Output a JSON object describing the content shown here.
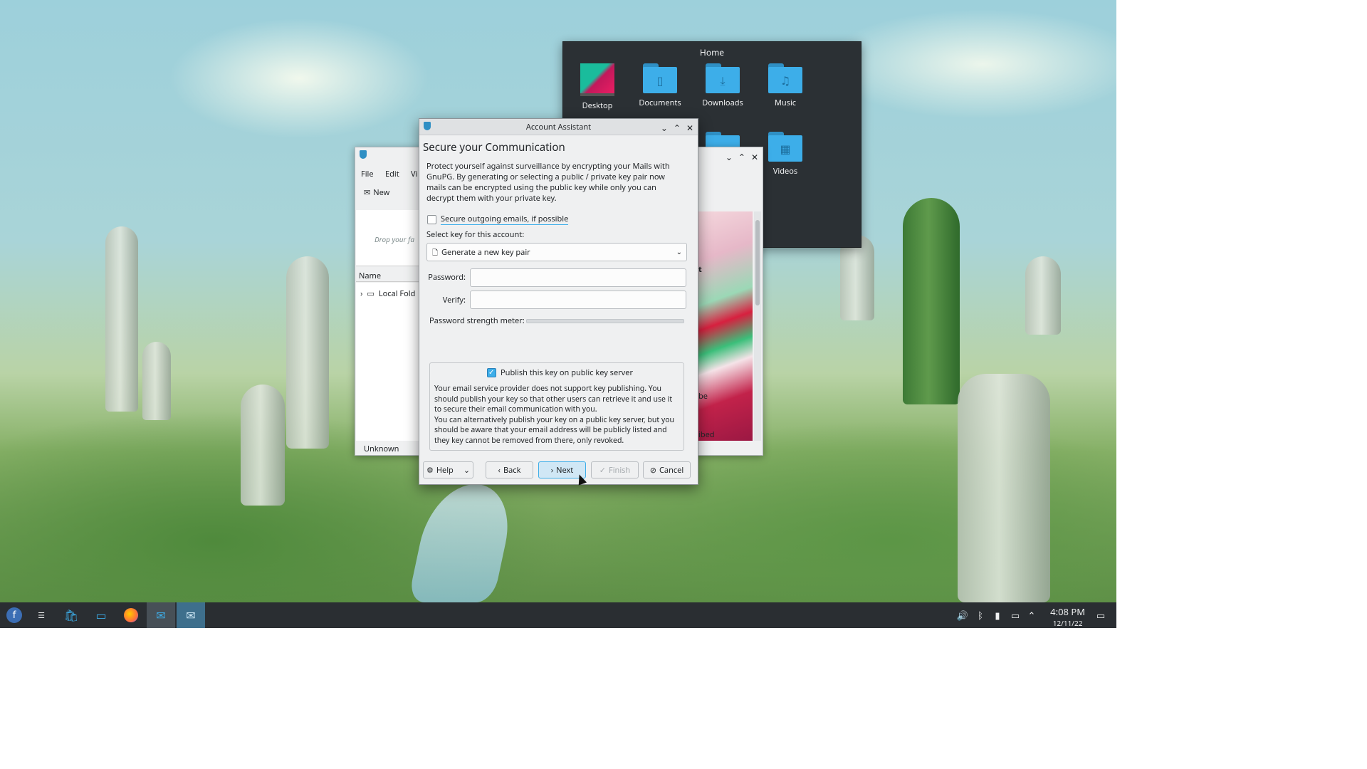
{
  "desktop": {
    "home_popup": {
      "title": "Home",
      "folders": [
        {
          "label": "Desktop",
          "icon": "desktop-folder-icon"
        },
        {
          "label": "Documents",
          "icon": "documents-folder-icon"
        },
        {
          "label": "Downloads",
          "icon": "downloads-folder-icon"
        },
        {
          "label": "Music",
          "icon": "music-folder-icon"
        },
        {
          "label": "Videos",
          "icon": "videos-folder-icon"
        }
      ]
    }
  },
  "mail_window": {
    "menu": [
      "File",
      "Edit",
      "Vi"
    ],
    "toolbar_new": "New",
    "drop_hint": "Drop your fa",
    "column_name": "Name",
    "folder_item": "Local Fold",
    "status": "Unknown",
    "preview_fragments": [
      "t",
      "be",
      "ibed"
    ]
  },
  "dialog": {
    "window_title": "Account Assistant",
    "heading": "Secure your Communication",
    "description": "Protect yourself against surveillance by encrypting your Mails with GnuPG. By generating or selecting a public / private key pair now mails can be encrypted using the public key while only you can decrypt them with your private key.",
    "secure_checkbox_label": "Secure outgoing emails, if possible",
    "secure_checked": false,
    "select_key_label": "Select key for this account:",
    "key_combo_value": "Generate a new key pair",
    "password_label": "Password:",
    "verify_label": "Verify:",
    "password_value": "",
    "verify_value": "",
    "strength_label": "Password strength meter:",
    "strength_level": 0,
    "publish_label": "Publish this key on public key server",
    "publish_checked": true,
    "publish_text_1": "Your email service provider does not support key publishing. You should publish your key so that other users can retrieve it and use it to secure their email communication with you.",
    "publish_text_2": "You can alternatively publish your key on a public key server, but you should be aware that your email address will be publicly listed and they key cannot be removed from there, only revoked.",
    "buttons": {
      "help": "Help",
      "back": "Back",
      "next": "Next",
      "finish": "Finish",
      "cancel": "Cancel"
    }
  },
  "taskbar": {
    "time": "4:08 PM",
    "date": "12/11/22"
  },
  "colors": {
    "accent": "#3daee9",
    "taskbar": "#2a2e32",
    "panel_dark": "#2b3034"
  }
}
